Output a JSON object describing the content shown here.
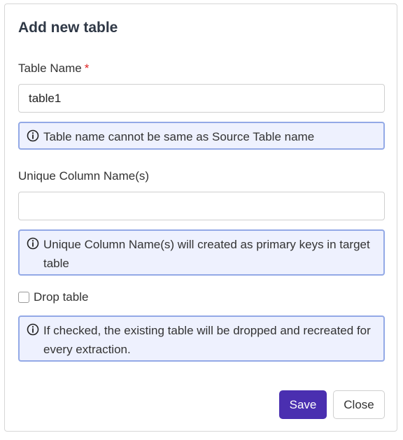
{
  "dialog": {
    "title": "Add new table"
  },
  "table_name": {
    "label": "Table Name",
    "required_marker": "*",
    "value": "table1",
    "info": "Table name cannot be same as Source Table name"
  },
  "unique_columns": {
    "label": "Unique Column Name(s)",
    "value": "",
    "placeholder": "",
    "info": "Unique Column Name(s) will created as primary keys in target table"
  },
  "drop_table": {
    "label": "Drop table",
    "checked": false,
    "info": "If checked, the existing table will be dropped and recreated for every extraction."
  },
  "footer": {
    "save_label": "Save",
    "close_label": "Close"
  },
  "colors": {
    "primary": "#4a2fb0",
    "info_border": "#93a9e6",
    "info_background": "#eef1fe",
    "required": "#e02424"
  },
  "icons": {
    "info": "info-circle-icon"
  }
}
